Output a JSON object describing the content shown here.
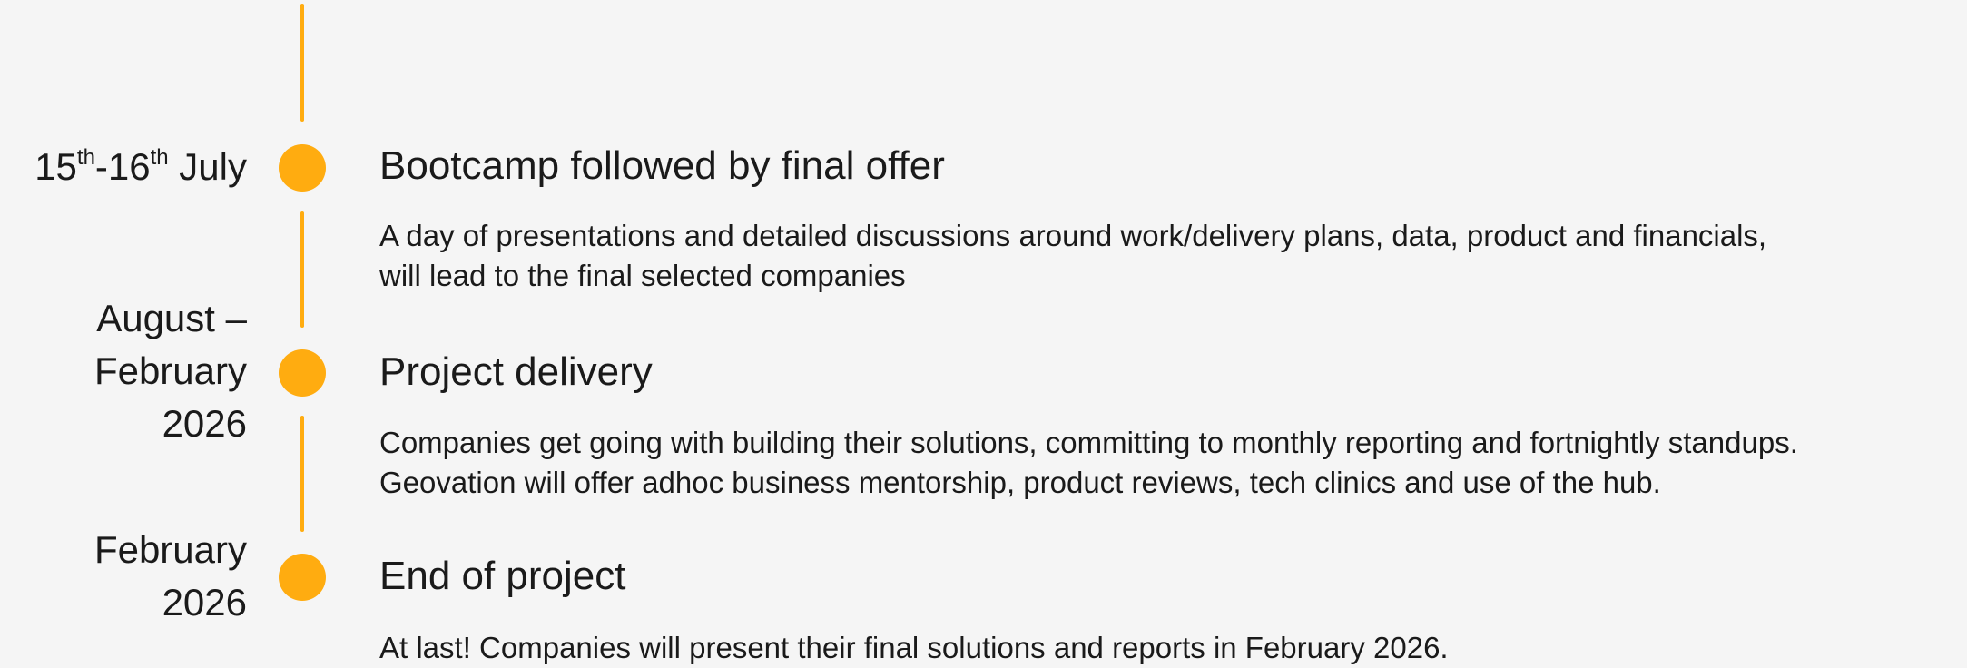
{
  "theme": {
    "accent": "#ffac10",
    "background": "#f5f5f5",
    "text": "#1a1a1a"
  },
  "events": [
    {
      "date_parts": [
        "15",
        "th",
        "-16",
        "th",
        " July"
      ],
      "title": "Bootcamp followed by final offer",
      "description": [
        "A day of presentations and detailed discussions around work/delivery plans, data, product and financials,",
        "will lead to the final selected companies"
      ]
    },
    {
      "date_lines": [
        "August –",
        "February",
        "2026"
      ],
      "title": "Project delivery",
      "description": [
        "Companies get going with building their solutions, committing to monthly reporting and fortnightly standups.",
        "Geovation will offer adhoc business mentorship, product reviews, tech clinics and use of the hub."
      ]
    },
    {
      "date_lines": [
        "February",
        "2026"
      ],
      "title": "End of project",
      "description": [
        "At last! Companies will present their final solutions and reports in February 2026."
      ]
    }
  ]
}
